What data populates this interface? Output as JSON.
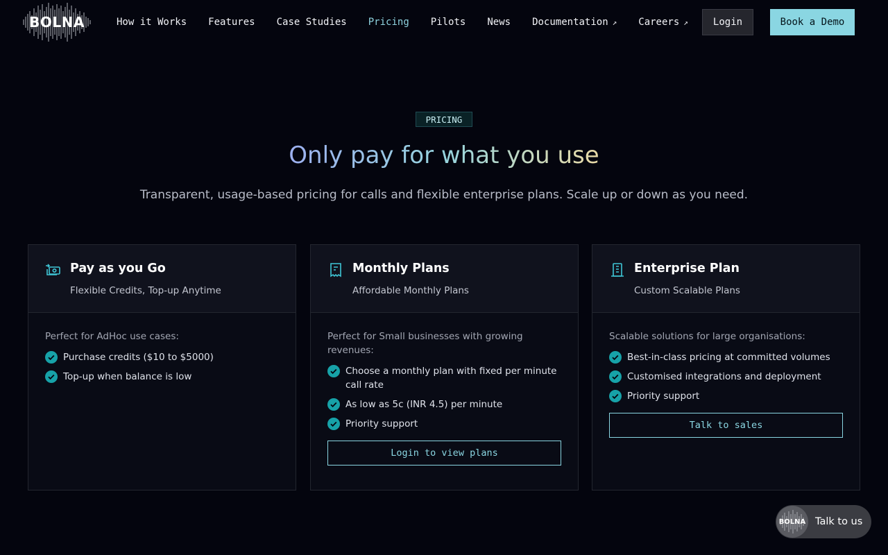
{
  "brand": {
    "logo_text": "BOLNA"
  },
  "nav": {
    "links": [
      {
        "label": "How it Works"
      },
      {
        "label": "Features"
      },
      {
        "label": "Case Studies"
      },
      {
        "label": "Pricing"
      },
      {
        "label": "Pilots"
      },
      {
        "label": "News"
      },
      {
        "label": "Documentation"
      },
      {
        "label": "Careers"
      }
    ],
    "login_label": "Login",
    "demo_label": "Book a Demo"
  },
  "hero": {
    "badge": "PRICING",
    "title": "Only pay for what you use",
    "subtitle": "Transparent, usage-based pricing for calls and flexible enterprise plans. Scale up or down as you need."
  },
  "plans": [
    {
      "icon": "money-icon",
      "title": "Pay as you Go",
      "subtitle": "Flexible Credits, Top-up Anytime",
      "description": "Perfect for AdHoc use cases:",
      "features": [
        "Purchase credits ($10 to $5000)",
        "Top-up when balance is low"
      ]
    },
    {
      "icon": "receipt-icon",
      "title": "Monthly Plans",
      "subtitle": "Affordable Monthly Plans",
      "description": "Perfect for Small businesses with growing revenues:",
      "features": [
        "Choose a monthly plan with fixed per minute call rate",
        "As low as 5c (INR 4.5) per minute",
        "Priority support"
      ],
      "button": "Login to view plans"
    },
    {
      "icon": "building-icon",
      "title": "Enterprise Plan",
      "subtitle": "Custom Scalable Plans",
      "description": "Scalable solutions for large organisations:",
      "features": [
        "Best-in-class pricing at committed volumes",
        "Customised integrations and deployment",
        "Priority support"
      ],
      "button": "Talk to sales"
    }
  ],
  "floating": {
    "avatar_text": "BOLNA",
    "label": "Talk to us"
  },
  "colors": {
    "accent": "#8ad6e2",
    "check": "#17a2a8",
    "background": "#04050e"
  }
}
